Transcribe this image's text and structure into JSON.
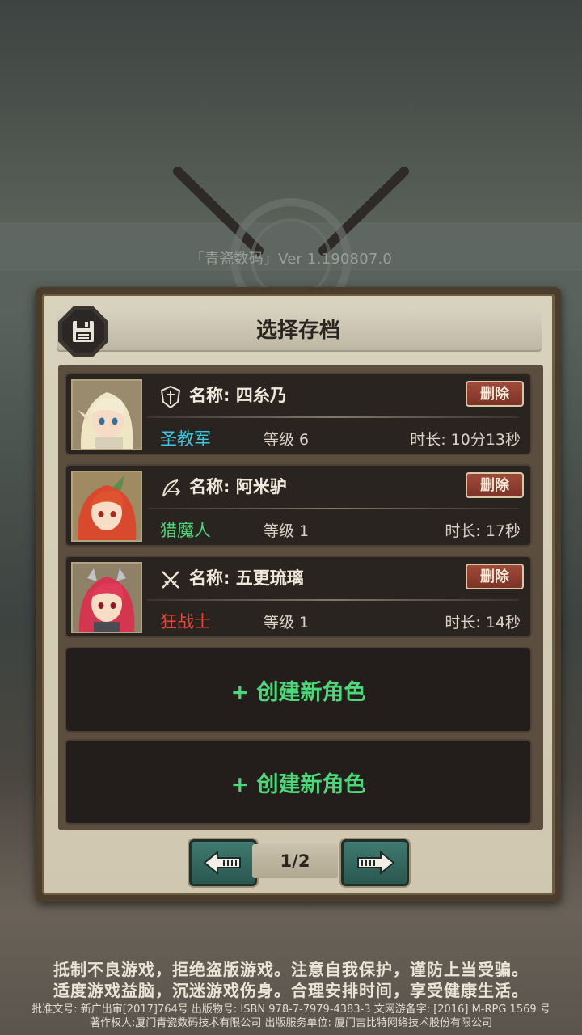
{
  "version_text": "「青瓷数码」Ver 1.190807.0",
  "dialog": {
    "title": "选择存档",
    "save_icon": "floppy-disk-icon"
  },
  "slots": [
    {
      "name": "名称: 四糸乃",
      "class_name": "圣教军",
      "class_color": "#3cc6e0",
      "class_icon": "cross-shield-icon",
      "level": "等级 6",
      "duration": "时长: 10分13秒",
      "delete_label": "删除",
      "portrait": "blonde-elf-portrait"
    },
    {
      "name": "名称: 阿米驴",
      "class_name": "猎魔人",
      "class_color": "#4ed67a",
      "class_icon": "crossbow-icon",
      "level": "等级 1",
      "duration": "时长: 17秒",
      "delete_label": "删除",
      "portrait": "red-hair-bunny-portrait"
    },
    {
      "name": "名称: 五更琉璃",
      "class_name": "狂战士",
      "class_color": "#e8463a",
      "class_icon": "crossed-swords-icon",
      "level": "等级 1",
      "duration": "时长: 14秒",
      "delete_label": "删除",
      "portrait": "red-twintail-portrait"
    }
  ],
  "create_slots": [
    {
      "label": "+ 创建新角色"
    },
    {
      "label": "+ 创建新角色"
    }
  ],
  "pager": {
    "page": "1/2",
    "prev_icon": "arrow-left-icon",
    "next_icon": "arrow-right-icon"
  },
  "footer": {
    "line1": "抵制不良游戏，拒绝盗版游戏。注意自我保护，谨防上当受骗。",
    "line2": "适度游戏益脑，沉迷游戏伤身。合理安排时间，享受健康生活。",
    "line3": "批准文号: 新广出审[2017]764号 出版物号: ISBN 978-7-7979-4383-3 文网游备字: [2016] M-RPG 1569 号",
    "line4": "著作权人:厦门青瓷数码技术有限公司 出版服务单位: 厦门吉比特网络技术股份有限公司"
  }
}
